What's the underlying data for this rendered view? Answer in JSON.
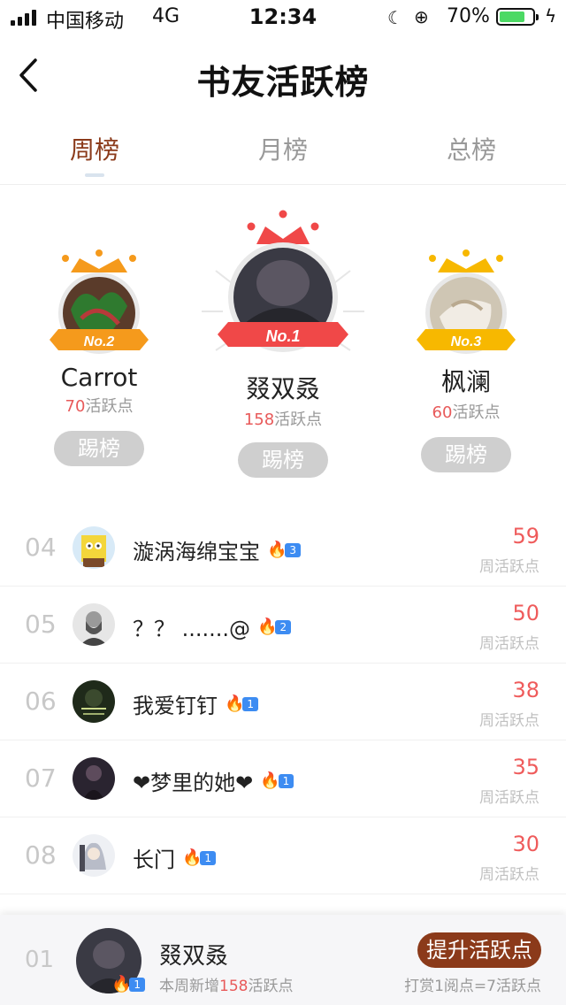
{
  "status_bar": {
    "carrier": "中国移动",
    "network": "4G",
    "time": "12:34",
    "battery": "70%",
    "battery_level": 0.7,
    "battery_color": "#4cd964"
  },
  "nav": {
    "title": "书友活跃榜",
    "back_icon": "chevron-left-icon"
  },
  "tabs": [
    {
      "label": "周榜",
      "active": true
    },
    {
      "label": "月榜",
      "active": false
    },
    {
      "label": "总榜",
      "active": false
    }
  ],
  "podium": {
    "first": {
      "rank_badge": "No.1",
      "name": "叕双叒",
      "points": "158",
      "points_suffix": "活跃点",
      "button": "踢榜",
      "crown_color": "#f04848",
      "ribbon_color": "#f04848"
    },
    "second": {
      "rank_badge": "No.2",
      "name": "Carrot",
      "points": "70",
      "points_suffix": "活跃点",
      "button": "踢榜",
      "crown_color": "#f59a1c",
      "ribbon_color": "#f59a1c"
    },
    "third": {
      "rank_badge": "No.3",
      "name": "枫澜",
      "points": "60",
      "points_suffix": "活跃点",
      "button": "踢榜",
      "crown_color": "#f7b800",
      "ribbon_color": "#f7b800"
    }
  },
  "list": [
    {
      "rank": "04",
      "name": "漩涡海绵宝宝",
      "level": "3",
      "score": "59",
      "score_label": "周活跃点"
    },
    {
      "rank": "05",
      "name": "？？ .......@",
      "level": "2",
      "score": "50",
      "score_label": "周活跃点"
    },
    {
      "rank": "06",
      "name": "我爱钉钉",
      "level": "1",
      "score": "38",
      "score_label": "周活跃点"
    },
    {
      "rank": "07",
      "name": "❤梦里的她❤",
      "level": "1",
      "score": "35",
      "score_label": "周活跃点"
    },
    {
      "rank": "08",
      "name": "长门",
      "level": "1",
      "score": "30",
      "score_label": "周活跃点"
    }
  ],
  "my_bar": {
    "rank": "01",
    "name": "叕双叒",
    "level": "1",
    "sub_prefix": "本周新增",
    "sub_points": "158",
    "sub_suffix": "活跃点",
    "button": "提升活跃点",
    "hint": "打赏1阅点=7活跃点"
  },
  "colors": {
    "accent_brown": "#8b3a1a",
    "score_red": "#ef5b5b",
    "level_blue": "#3d8cf2"
  }
}
